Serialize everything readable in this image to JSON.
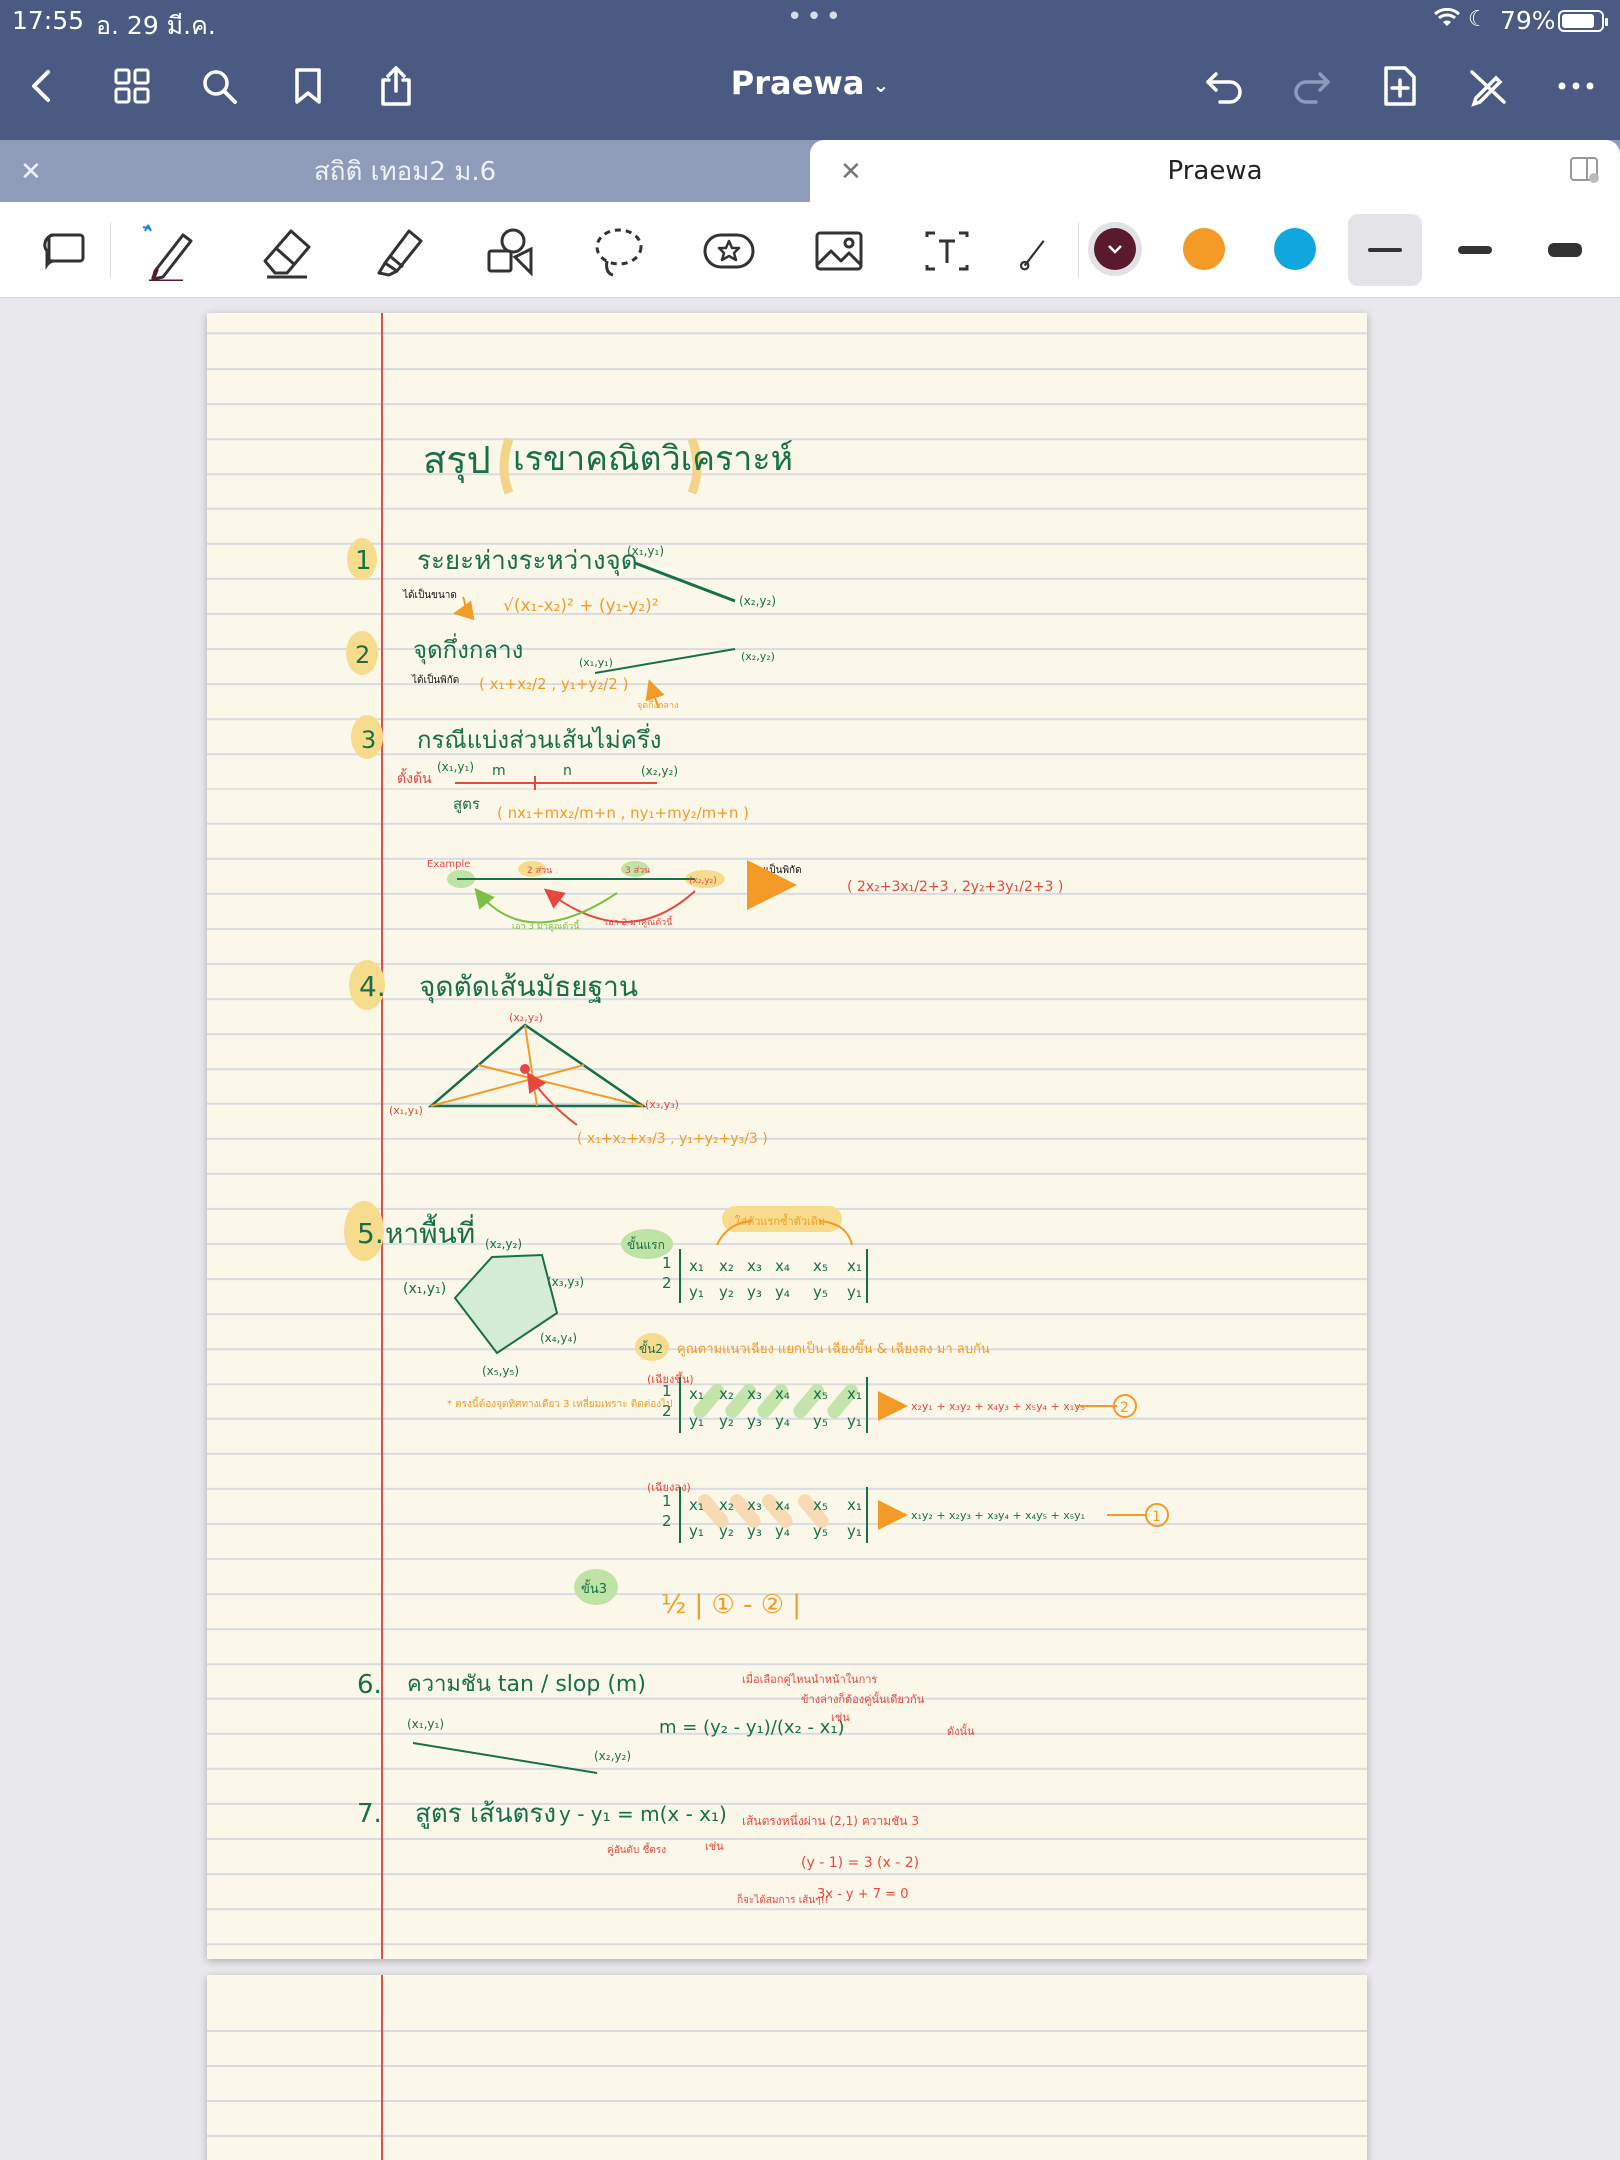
{
  "status_bar": {
    "time": "17:55",
    "date": "อ. 29 มี.ค.",
    "battery": "79%",
    "dots": "•••"
  },
  "nav": {
    "title": "Praewa"
  },
  "tabs": [
    {
      "label": "สถิติ เทอม2 ม.6",
      "active": false
    },
    {
      "label": "Praewa",
      "active": true
    }
  ],
  "toolbar": {
    "colors": [
      "#5a1a2e",
      "#f39b26",
      "#10a6de"
    ],
    "selected_color": "#5a1a2e"
  },
  "note": {
    "title": "สรุป",
    "title_box": "เรขาคณิตวิเคราะห์",
    "s1": {
      "num": "1",
      "heading": "ระยะห่างระหว่างจุด",
      "side": "ได้เป็นขนาด",
      "formula": "√(x₁-x₂)² + (y₁-y₂)²",
      "p1": "(x₁,y₁)",
      "p2": "(x₂,y₂)"
    },
    "s2": {
      "num": "2",
      "heading": "จุดกึ่งกลาง",
      "side": "ได้เป็นพิกัด",
      "formula": "( x₁+x₂/2 , y₁+y₂/2 )",
      "p1": "(x₁,y₁)",
      "p2": "(x₂,y₂)",
      "mid": "จุดกึ่งกลาง"
    },
    "s3": {
      "num": "3",
      "heading": "กรณีแบ่งส่วนเส้นไม่ครึ่ง",
      "start": "ตั้งต้น",
      "p1": "(x₁,y₁)",
      "p2": "(x₂,y₂)",
      "m": "m",
      "n": "n",
      "formula_label": "สูตร",
      "formula": "( nx₁+mx₂/m+n , ny₁+my₂/m+n )",
      "example": "Example",
      "ex_m": "2 ส่วน",
      "ex_n": "3 ส่วน",
      "ex_p": "(x₂,y₂)",
      "ex_g": "เอา 3 มาคูณตัวนี้",
      "ex_r": "เอา 2 มาคูณตัวนี้",
      "answer_label": "ตอบเป็นพิกัด",
      "answer": "( 2x₂+3x₁/2+3 , 2y₂+3y₁/2+3 )"
    },
    "s4": {
      "num": "4.",
      "heading": "จุดตัดเส้นมัธยฐาน",
      "top": "(x₂,y₂)",
      "left": "(x₁,y₁)",
      "right": "(x₃,y₃)",
      "formula": "( x₁+x₂+x₃/3 , y₁+y₂+y₃/3 )"
    },
    "s5": {
      "num": "5.",
      "heading": "หาพื้นที่",
      "pts": [
        "(x₁,y₁)",
        "(x₂,y₂)",
        "(x₃,y₃)",
        "(x₄,y₄)",
        "(x₅,y₅)"
      ],
      "note": "* ตรงนี้ต้องจุดทิศทางเดียว 3 เหลี่ยมเพราะ ติดต่องไป",
      "step1": "ขั้นแรก",
      "step1_note": "ใส่ตัวแรกซ้ำตัวเดิม",
      "step2": "ขั้น2",
      "step2_note": "คูณตามแนวเฉียง แยกเป็น เฉียงขึ้น & เฉียงลง มา ลบกัน",
      "up": "(เฉียงขึ้น)",
      "down": "(เฉียงลง)",
      "up_result": "x₂y₁ + x₃y₂ + x₄y₃ + x₅y₄ + x₁y₅",
      "down_result": "x₁y₂ + x₂y₃ + x₃y₄ + x₄y₅ + x₅y₁",
      "r_up": "2",
      "r_down": "1",
      "step3": "ขั้น3",
      "final": "½ | ① - ② |"
    },
    "s6": {
      "num": "6.",
      "heading": "ความชัน  tan / slop  (m)",
      "p1": "(x₁,y₁)",
      "p2": "(x₂,y₂)",
      "formula": "m = (y₂ - y₁)/(x₂ - x₁)",
      "note1": "เมื่อเลือกคู่ไหนนำหน้าในการ",
      "note2": "ข้างล่างก็ต้องคู่นั้นเดียวกัน",
      "ex": "เช่น",
      "ex_also": "ดังนั้น"
    },
    "s7": {
      "num": "7.",
      "heading": "สูตร เส้นตรง",
      "formula": "y - y₁ = m(x - x₁)",
      "hint": "คู่อันดับ ชี้ตรง",
      "ex": "เช่น",
      "ex_q": "เส้นตรงหนึ่งผ่าน (2,1) ความชัน 3",
      "ex_a1": "(y - 1) = 3 (x - 2)",
      "ex_a2": "3x - y + 7 = 0",
      "ex_tail": "ก็จะได้สมการ เส้นๆ!!"
    }
  }
}
